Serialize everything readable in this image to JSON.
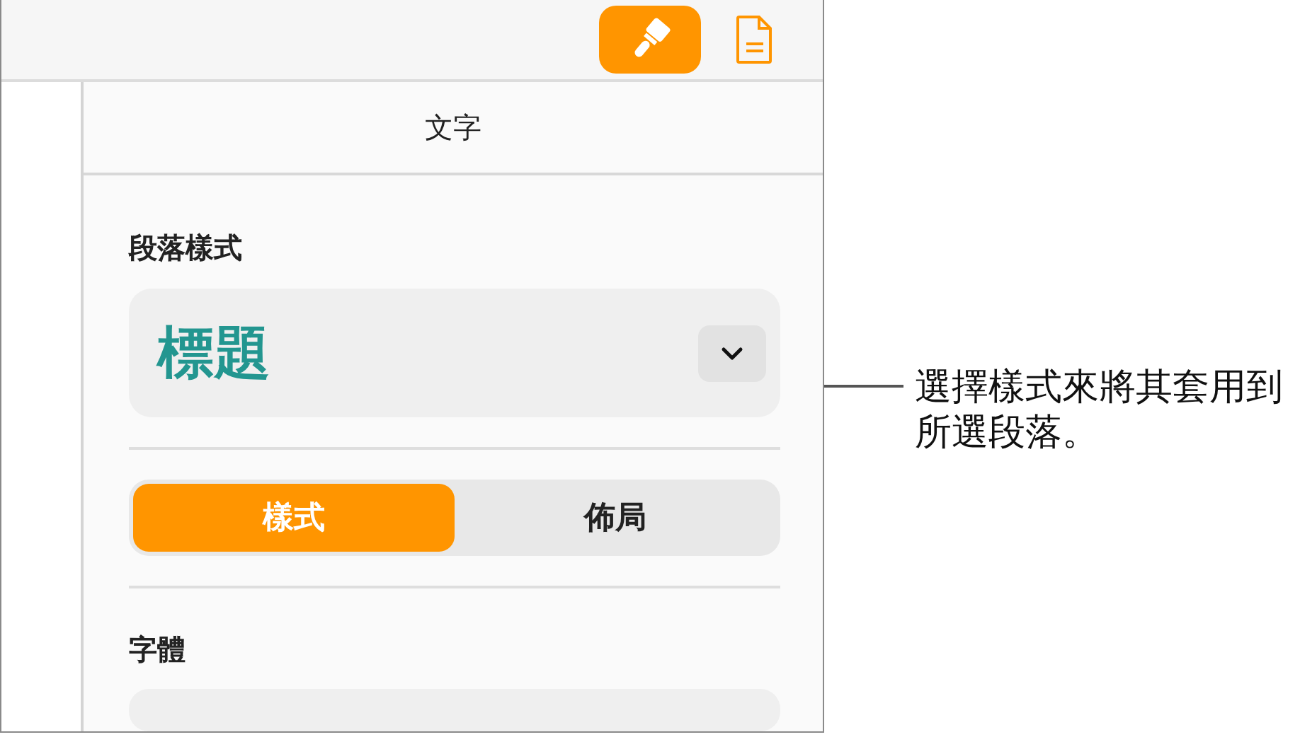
{
  "toolbar": {
    "buttons": [
      {
        "kind": "format",
        "selected": true
      },
      {
        "kind": "document",
        "selected": false
      }
    ]
  },
  "sidebar": {
    "title": "文字",
    "paragraph_style": {
      "label": "段落樣式",
      "value": "標題"
    },
    "tabs": [
      {
        "label": "樣式",
        "selected": true
      },
      {
        "label": "佈局",
        "selected": false
      }
    ],
    "font": {
      "label": "字體"
    }
  },
  "callout": {
    "text": "選擇樣式來將其套用到所選段落。"
  }
}
